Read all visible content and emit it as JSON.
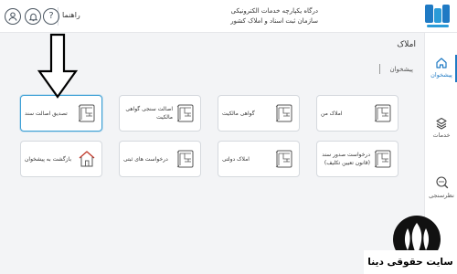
{
  "header": {
    "help_label": "راهنما",
    "help_glyph": "?",
    "portal_title_line1": "درگاه یکپارچه خدمات الکترونیکی",
    "portal_title_line2": "سازمان ثبت اسناد و املاک کشور"
  },
  "sidebar": {
    "items": [
      {
        "label": "پیشخوان",
        "icon": "home-icon",
        "active": true
      },
      {
        "label": "خدمات",
        "icon": "layers-icon",
        "active": false
      },
      {
        "label": "نظرسنجی",
        "icon": "chat-search-icon",
        "active": false
      }
    ]
  },
  "main": {
    "title": "املاک",
    "section": "پیشخوان",
    "cards": [
      {
        "label": "املاک من",
        "icon": "blueprint-icon",
        "selected": false
      },
      {
        "label": "گواهی مالکیت",
        "icon": "blueprint-icon",
        "selected": false
      },
      {
        "label": "اصالت سنجی گواهی مالکیت",
        "icon": "blueprint-icon",
        "selected": false
      },
      {
        "label": "تصدیق اصالت سند",
        "icon": "blueprint-icon",
        "selected": true
      },
      {
        "label": "درخواست صدور سند (قانون تعیین تکلیف)",
        "icon": "blueprint-icon",
        "selected": false
      },
      {
        "label": "املاک دولتی",
        "icon": "blueprint-icon",
        "selected": false
      },
      {
        "label": "درخواست های ثبتی",
        "icon": "blueprint-icon",
        "selected": false
      },
      {
        "label": "بازگشت به پیشخوان",
        "icon": "house-icon",
        "selected": false
      }
    ]
  },
  "watermark": {
    "text": "سایت حقوقی دینا"
  },
  "colors": {
    "accent": "#1f7ac4",
    "selected_border": "#3fa1d6",
    "background": "#f3f4f6"
  }
}
